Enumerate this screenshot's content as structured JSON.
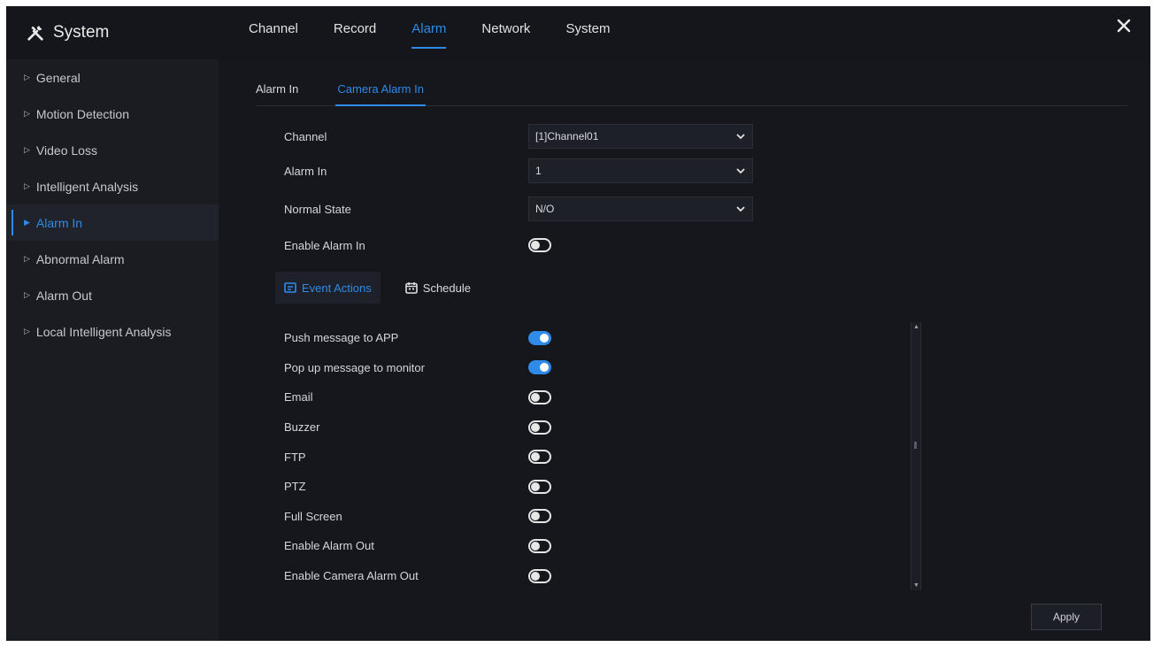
{
  "app": {
    "title": "System",
    "close_icon": "close-icon",
    "logo_icon": "tools-icon"
  },
  "nav": {
    "items": [
      {
        "label": "Channel",
        "active": false
      },
      {
        "label": "Record",
        "active": false
      },
      {
        "label": "Alarm",
        "active": true
      },
      {
        "label": "Network",
        "active": false
      },
      {
        "label": "System",
        "active": false
      }
    ]
  },
  "sidebar": {
    "items": [
      {
        "label": "General",
        "active": false
      },
      {
        "label": "Motion Detection",
        "active": false
      },
      {
        "label": "Video Loss",
        "active": false
      },
      {
        "label": "Intelligent Analysis",
        "active": false
      },
      {
        "label": "Alarm In",
        "active": true
      },
      {
        "label": "Abnormal Alarm",
        "active": false
      },
      {
        "label": "Alarm Out",
        "active": false
      },
      {
        "label": "Local Intelligent Analysis",
        "active": false
      }
    ]
  },
  "subtabs": [
    {
      "label": "Alarm In",
      "active": false
    },
    {
      "label": "Camera Alarm In",
      "active": true
    }
  ],
  "form": {
    "channel": {
      "label": "Channel",
      "value": "[1]Channel01"
    },
    "alarm_in": {
      "label": "Alarm In",
      "value": "1"
    },
    "normal_state": {
      "label": "Normal State",
      "value": "N/O"
    },
    "enable_alarm_in": {
      "label": "Enable Alarm In",
      "on": false
    }
  },
  "action_tabs": [
    {
      "label": "Event Actions",
      "icon": "event-actions-icon",
      "active": true
    },
    {
      "label": "Schedule",
      "icon": "calendar-icon",
      "active": false
    }
  ],
  "actions": [
    {
      "label": "Push message to APP",
      "on": true
    },
    {
      "label": "Pop up message to monitor",
      "on": true
    },
    {
      "label": "Email",
      "on": false
    },
    {
      "label": "Buzzer",
      "on": false
    },
    {
      "label": "FTP",
      "on": false
    },
    {
      "label": "PTZ",
      "on": false
    },
    {
      "label": "Full Screen",
      "on": false
    },
    {
      "label": "Enable Alarm Out",
      "on": false
    },
    {
      "label": "Enable Camera Alarm Out",
      "on": false
    }
  ],
  "apply_label": "Apply",
  "colors": {
    "accent": "#2f8ae8",
    "background": "#15171d",
    "sidebar": "#1a1c22"
  }
}
